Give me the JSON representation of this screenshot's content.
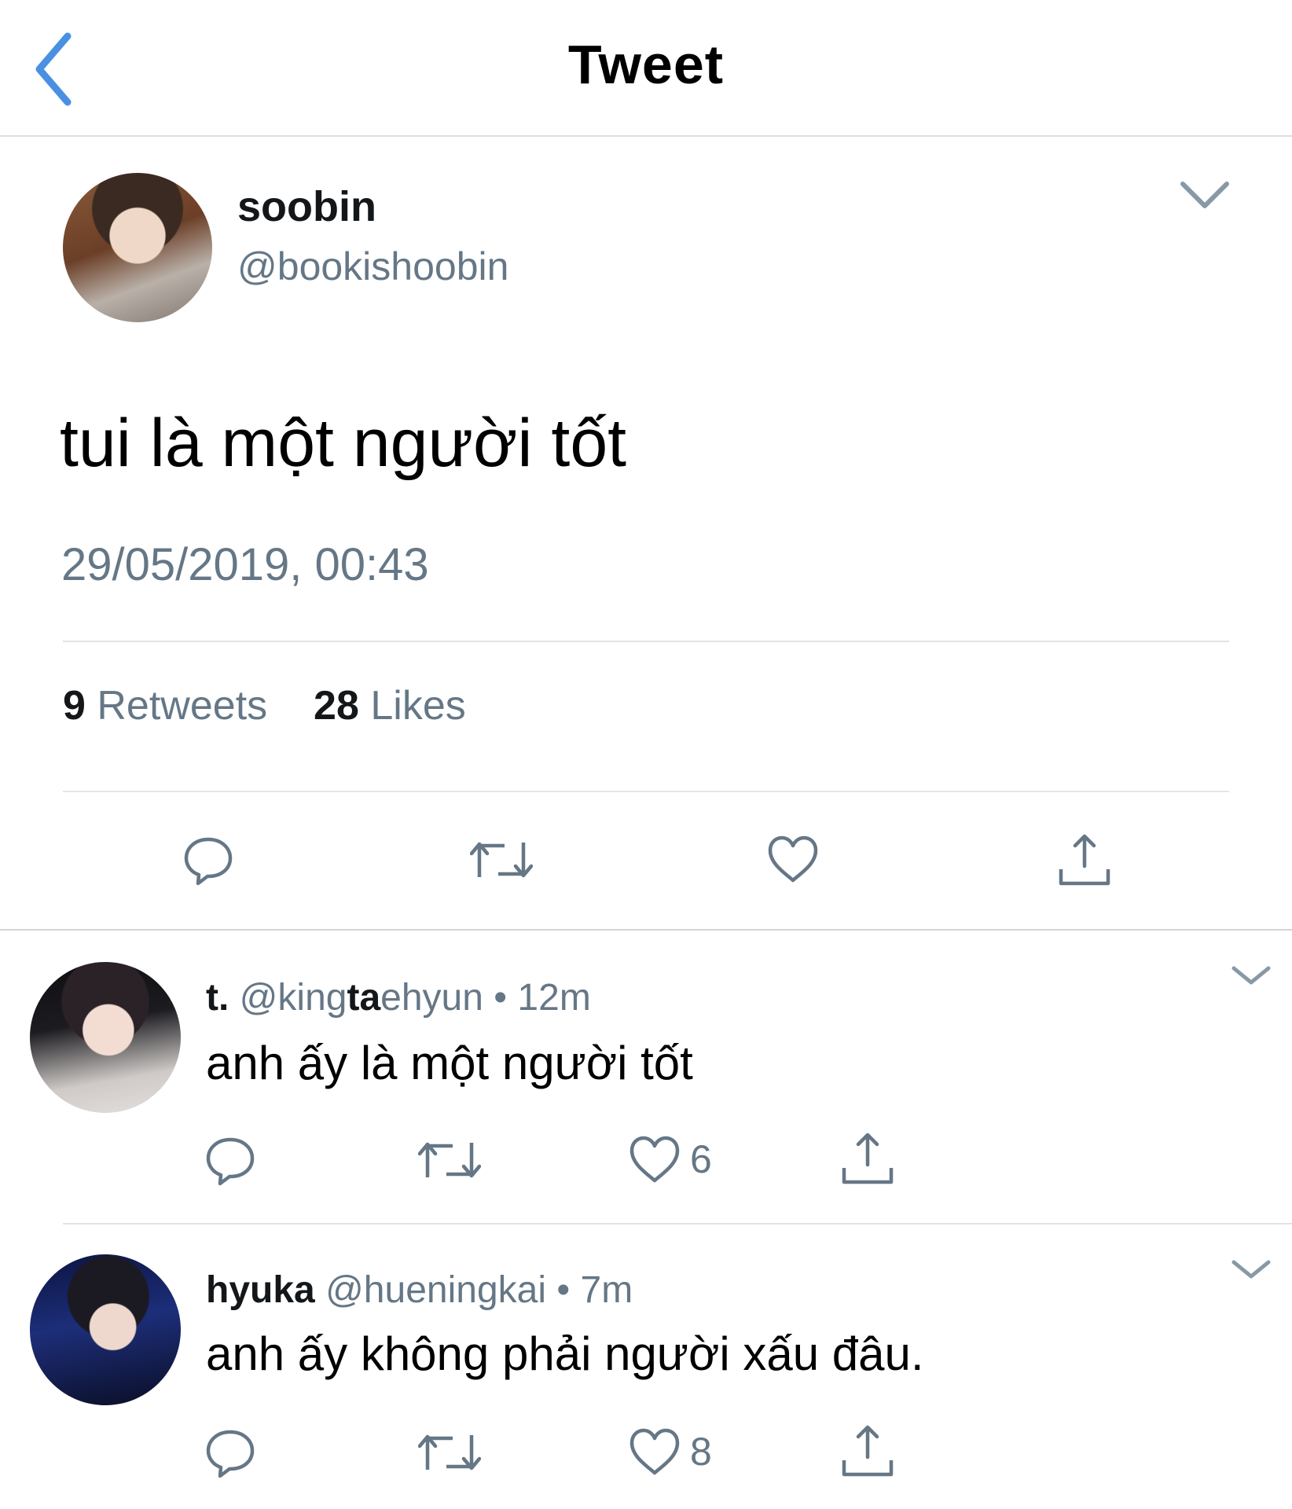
{
  "header": {
    "title": "Tweet"
  },
  "tweet": {
    "name": "soobin",
    "handle": "@bookishoobin",
    "text": "tui là một người tốt",
    "timestamp": "29/05/2019, 00:43",
    "retweets_count": "9",
    "retweets_label": "Retweets",
    "likes_count": "28",
    "likes_label": "Likes"
  },
  "replies": [
    {
      "name": "t.",
      "handle_prefix": "@king",
      "handle_highlight": "ta",
      "handle_suffix": "ehyun",
      "separator": "•",
      "time": "12m",
      "text": "anh ấy là một người tốt",
      "like_count": "6"
    },
    {
      "name": "hyuka",
      "handle": "@hueningkai",
      "separator": "•",
      "time": "7m",
      "text": "anh ấy không phải người xấu đâu.",
      "like_count": "8"
    }
  ],
  "colors": {
    "accent": "#4a90e2",
    "icon_gray": "#657786",
    "text_dark": "#14171a",
    "divider": "#e1e5e8"
  },
  "icons": {
    "back": "chevron-left-icon",
    "caret": "chevron-down-icon",
    "reply": "speech-bubble-icon",
    "retweet": "retweet-icon",
    "like": "heart-icon",
    "share": "share-icon"
  }
}
